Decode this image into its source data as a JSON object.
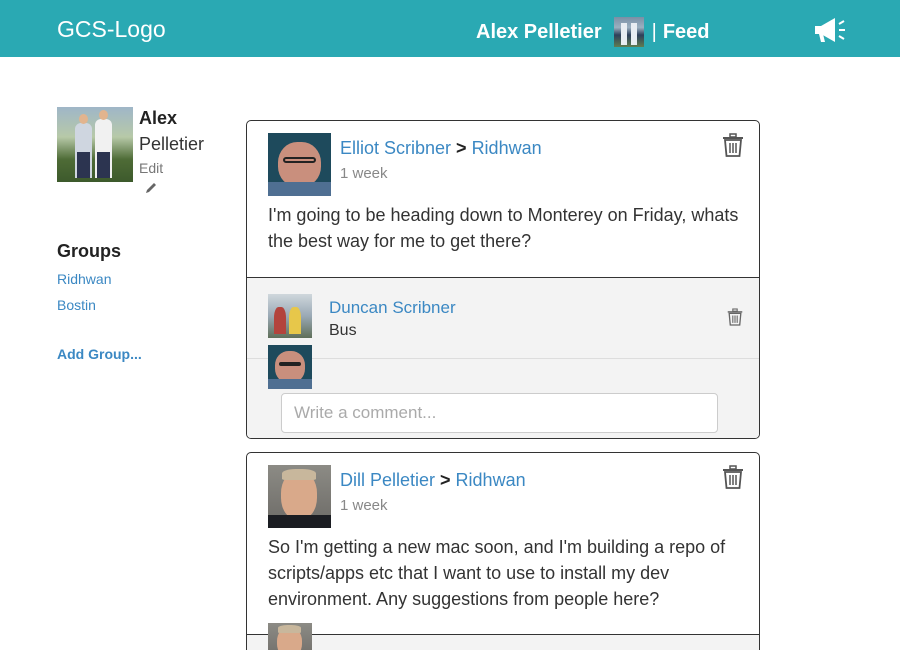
{
  "header": {
    "logo": "GCS-Logo",
    "user_name": "Alex Pelletier",
    "separator": "|",
    "feed_label": "Feed",
    "announce_icon": "megaphone-icon"
  },
  "profile": {
    "first_name": "Alex",
    "last_name": "Pelletier",
    "edit_label": "Edit",
    "edit_icon": "pencil-icon"
  },
  "groups": {
    "heading": "Groups",
    "items": [
      "Ridhwan",
      "Bostin"
    ],
    "add_label": "Add Group..."
  },
  "posts": [
    {
      "author": "Elliot Scribner",
      "arrow": ">",
      "group": "Ridhwan",
      "time": "1 week",
      "text": "I'm going to be heading down to Monterey on Friday, whats the best way for me to get there?",
      "comments": [
        {
          "author": "Duncan Scribner",
          "text": "Bus"
        }
      ],
      "comment_placeholder": "Write a comment..."
    },
    {
      "author": "Dill Pelletier",
      "arrow": ">",
      "group": "Ridhwan",
      "time": "1 week",
      "text": "So I'm getting a new mac soon, and I'm building a repo of scripts/apps etc that I want to use to install my dev environment. Any suggestions from people here?"
    }
  ],
  "colors": {
    "header_bg": "#2aa9b3",
    "link": "#3b88c3",
    "comment_bg": "#f3f3f3"
  }
}
